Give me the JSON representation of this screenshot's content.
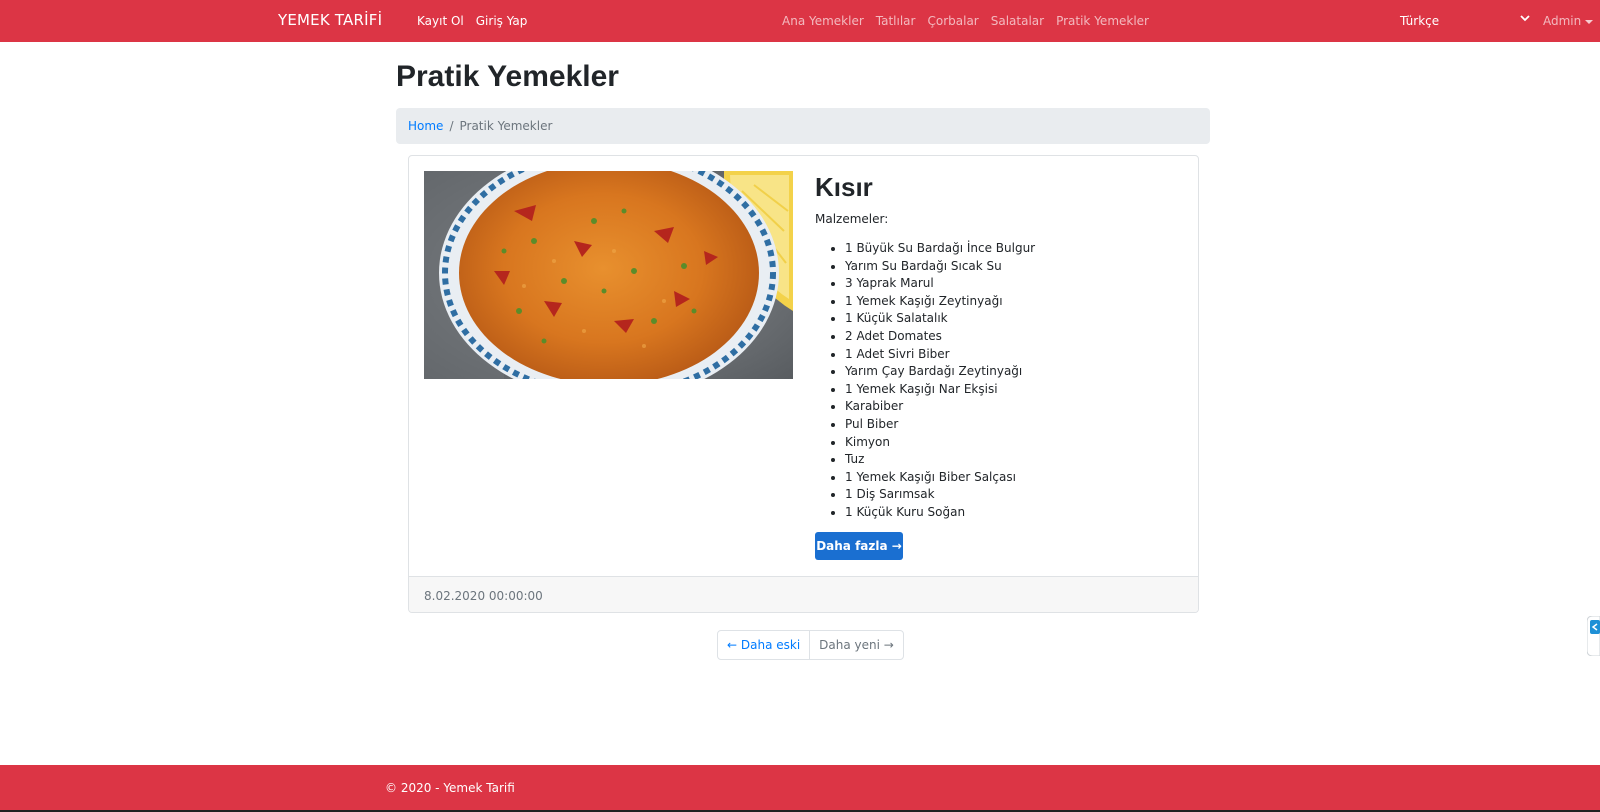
{
  "navbar": {
    "brand": "YEMEK TARİFİ",
    "auth_links": [
      "Kayıt Ol",
      "Giriş Yap"
    ],
    "categories": [
      "Ana Yemekler",
      "Tatlılar",
      "Çorbalar",
      "Salatalar",
      "Pratik Yemekler"
    ],
    "language": "Türkçe",
    "user": "Admin",
    "bg_color": "#dc3545"
  },
  "page": {
    "title": "Pratik Yemekler",
    "breadcrumb": {
      "home": "Home",
      "separator": "/",
      "current": "Pratik Yemekler"
    }
  },
  "recipe": {
    "title": "Kısır",
    "ingredients_label": "Malzemeler:",
    "ingredients": [
      "1 Büyük Su Bardağı İnce Bulgur",
      "Yarım Su Bardağı Sıcak Su",
      "3 Yaprak Marul",
      "1 Yemek Kaşığı Zeytinyağı",
      "1 Küçük Salatalık",
      "2 Adet Domates",
      "1 Adet Sivri Biber",
      "Yarım Çay Bardağı Zeytinyağı",
      "1 Yemek Kaşığı Nar Ekşisi",
      "Karabiber",
      "Pul Biber",
      "Kimyon",
      "Tuz",
      "1 Yemek Kaşığı Biber Salçası",
      "1 Diş Sarımsak",
      "1 Küçük Kuru Soğan"
    ],
    "more_button": "Daha fazla →",
    "date": "8.02.2020 00:00:00"
  },
  "pagination": {
    "older": "← Daha eski",
    "newer": "Daha yeni →"
  },
  "footer": {
    "text": "© 2020 - Yemek Tarifi"
  }
}
